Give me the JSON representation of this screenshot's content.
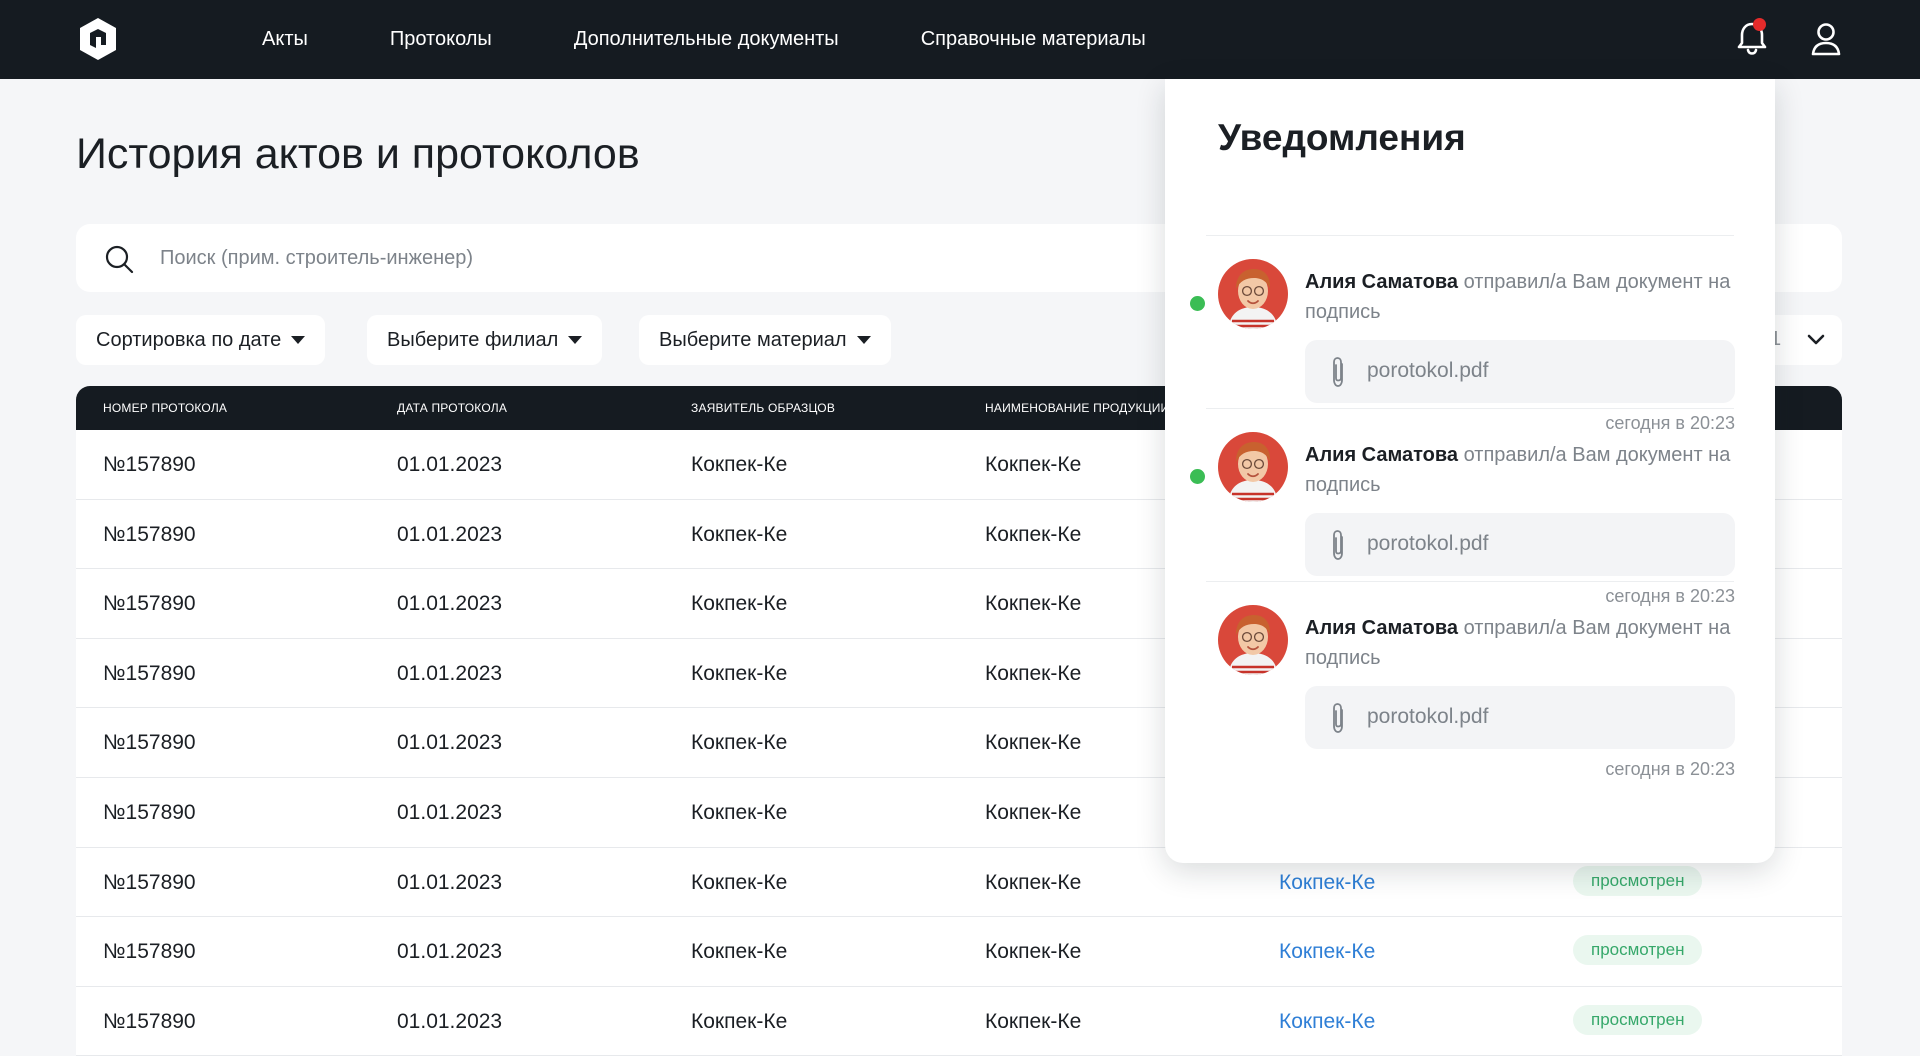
{
  "nav": {
    "items": [
      "Акты",
      "Протоколы",
      "Дополнительные документы",
      "Справочные материалы"
    ]
  },
  "page": {
    "title": "История актов и протоколов"
  },
  "search": {
    "placeholder": "Поиск (прим. строитель-инженер)",
    "value": ""
  },
  "filters": {
    "sort_label": "Сортировка по дате",
    "branch_label": "Выберите филиал",
    "material_label": "Выберите материал"
  },
  "pager": {
    "value": "1"
  },
  "table": {
    "headers": [
      "НОМЕР ПРОТОКОЛА",
      "ДАТА ПРОТОКОЛА",
      "ЗАЯВИТЕЛЬ ОБРАЗЦОВ",
      "НАИМЕНОВАНИЕ ПРОДУКЦИИ"
    ],
    "rows": [
      {
        "number": "№157890",
        "date": "01.01.2023",
        "applicant": "Кокпек-Ке",
        "product": "Кокпек-Ке",
        "link": "",
        "status": ""
      },
      {
        "number": "№157890",
        "date": "01.01.2023",
        "applicant": "Кокпек-Ке",
        "product": "Кокпек-Ке",
        "link": "",
        "status": ""
      },
      {
        "number": "№157890",
        "date": "01.01.2023",
        "applicant": "Кокпек-Ке",
        "product": "Кокпек-Ке",
        "link": "",
        "status": ""
      },
      {
        "number": "№157890",
        "date": "01.01.2023",
        "applicant": "Кокпек-Ке",
        "product": "Кокпек-Ке",
        "link": "",
        "status": ""
      },
      {
        "number": "№157890",
        "date": "01.01.2023",
        "applicant": "Кокпек-Ке",
        "product": "Кокпек-Ке",
        "link": "",
        "status": ""
      },
      {
        "number": "№157890",
        "date": "01.01.2023",
        "applicant": "Кокпек-Ке",
        "product": "Кокпек-Ке",
        "link": "",
        "status": ""
      },
      {
        "number": "№157890",
        "date": "01.01.2023",
        "applicant": "Кокпек-Ке",
        "product": "Кокпек-Ке",
        "link": "Кокпек-Ке",
        "status": "просмотрен"
      },
      {
        "number": "№157890",
        "date": "01.01.2023",
        "applicant": "Кокпек-Ке",
        "product": "Кокпек-Ке",
        "link": "Кокпек-Ке",
        "status": "просмотрен"
      },
      {
        "number": "№157890",
        "date": "01.01.2023",
        "applicant": "Кокпек-Ке",
        "product": "Кокпек-Ке",
        "link": "Кокпек-Ке",
        "status": "просмотрен"
      }
    ]
  },
  "notifications": {
    "title": "Уведомления",
    "items": [
      {
        "author": "Алия Саматова",
        "text": " отправил/а Вам документ на подпись",
        "file": "porotokol.pdf",
        "time": "сегодня в 20:23",
        "unread": true
      },
      {
        "author": "Алия Саматова",
        "text": " отправил/а Вам документ на подпись",
        "file": "porotokol.pdf",
        "time": "сегодня в 20:23",
        "unread": true
      },
      {
        "author": "Алия Саматова",
        "text": " отправил/а Вам документ на подпись",
        "file": "porotokol.pdf",
        "time": "сегодня в 20:23",
        "unread": false
      }
    ]
  },
  "icons": {
    "logo": "logo-icon",
    "bell": "bell-icon",
    "user": "user-icon",
    "search": "search-icon",
    "clip": "paperclip-icon",
    "chevron": "chevron-down-icon"
  },
  "colors": {
    "header_bg": "#151b21",
    "accent_link": "#2f7fd6",
    "status_green": "#36a86a",
    "unread_dot": "#3bbd55",
    "alert_dot": "#e42b2b"
  }
}
